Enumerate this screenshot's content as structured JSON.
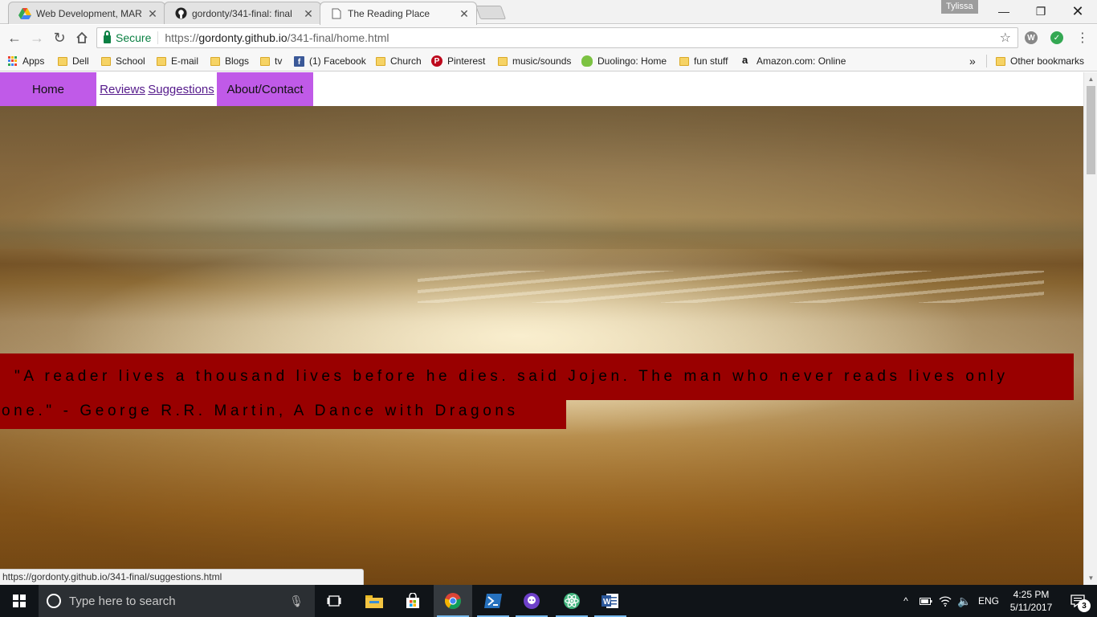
{
  "browser": {
    "tabs": [
      {
        "title": "Web Development, MAR",
        "icon": "google-drive-icon",
        "active": false
      },
      {
        "title": "gordonty/341-final: final",
        "icon": "github-icon",
        "active": false
      },
      {
        "title": "The Reading Place",
        "icon": "page-icon",
        "active": true
      }
    ],
    "user_badge": "Tylissa",
    "omnibox": {
      "secure_label": "Secure",
      "url_scheme": "https://",
      "url_host": "gordonty.github.io",
      "url_path": "/341-final/home.html"
    },
    "bookmarks": [
      {
        "label": "Apps",
        "icon": "apps-grid-icon"
      },
      {
        "label": "Dell",
        "icon": "folder-icon"
      },
      {
        "label": "School",
        "icon": "folder-icon"
      },
      {
        "label": "E-mail",
        "icon": "folder-icon"
      },
      {
        "label": "Blogs",
        "icon": "folder-icon"
      },
      {
        "label": "tv",
        "icon": "folder-icon"
      },
      {
        "label": "(1) Facebook",
        "icon": "facebook-icon"
      },
      {
        "label": "Church",
        "icon": "folder-icon"
      },
      {
        "label": "Pinterest",
        "icon": "pinterest-icon"
      },
      {
        "label": "music/sounds",
        "icon": "folder-icon"
      },
      {
        "label": "Duolingo: Home",
        "icon": "duolingo-icon"
      },
      {
        "label": "fun stuff",
        "icon": "folder-icon"
      },
      {
        "label": "Amazon.com: Online",
        "icon": "amazon-icon"
      }
    ],
    "overflow_label": "»",
    "other_bookmarks": "Other bookmarks",
    "status_url": "https://gordonty.github.io/341-final/suggestions.html"
  },
  "page": {
    "nav": {
      "home": "Home",
      "reviews": "Reviews",
      "suggestions": "Suggestions",
      "about": "About/Contact"
    },
    "quote_line1": " \"A reader lives a thousand lives before he dies. said Jojen. The man who never reads lives only",
    "quote_line2": "one.\" - George R.R. Martin, A Dance with Dragons",
    "colors": {
      "nav_accent": "#c05ae8",
      "quote_bg": "#990000",
      "link": "#551a8b"
    }
  },
  "taskbar": {
    "search_placeholder": "Type here to search",
    "language": "ENG",
    "time": "4:25 PM",
    "date": "5/11/2017",
    "notification_count": "3"
  }
}
